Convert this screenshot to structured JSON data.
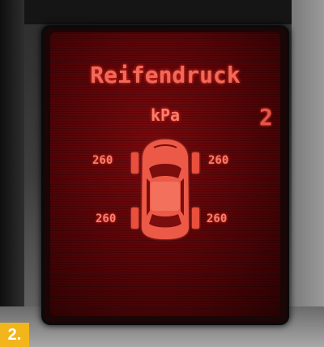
{
  "display": {
    "title": "Reifendruck",
    "unit": "kPa",
    "side_glyph": "2"
  },
  "tires": {
    "front_left": "260",
    "front_right": "260",
    "rear_left": "260",
    "rear_right": "260"
  },
  "figure_label": "2.",
  "colors": {
    "display_text": "#f06a5a",
    "screen_background": "#5a0508",
    "badge": "#f2b51c"
  },
  "icons": [
    "car-top-view-icon"
  ]
}
